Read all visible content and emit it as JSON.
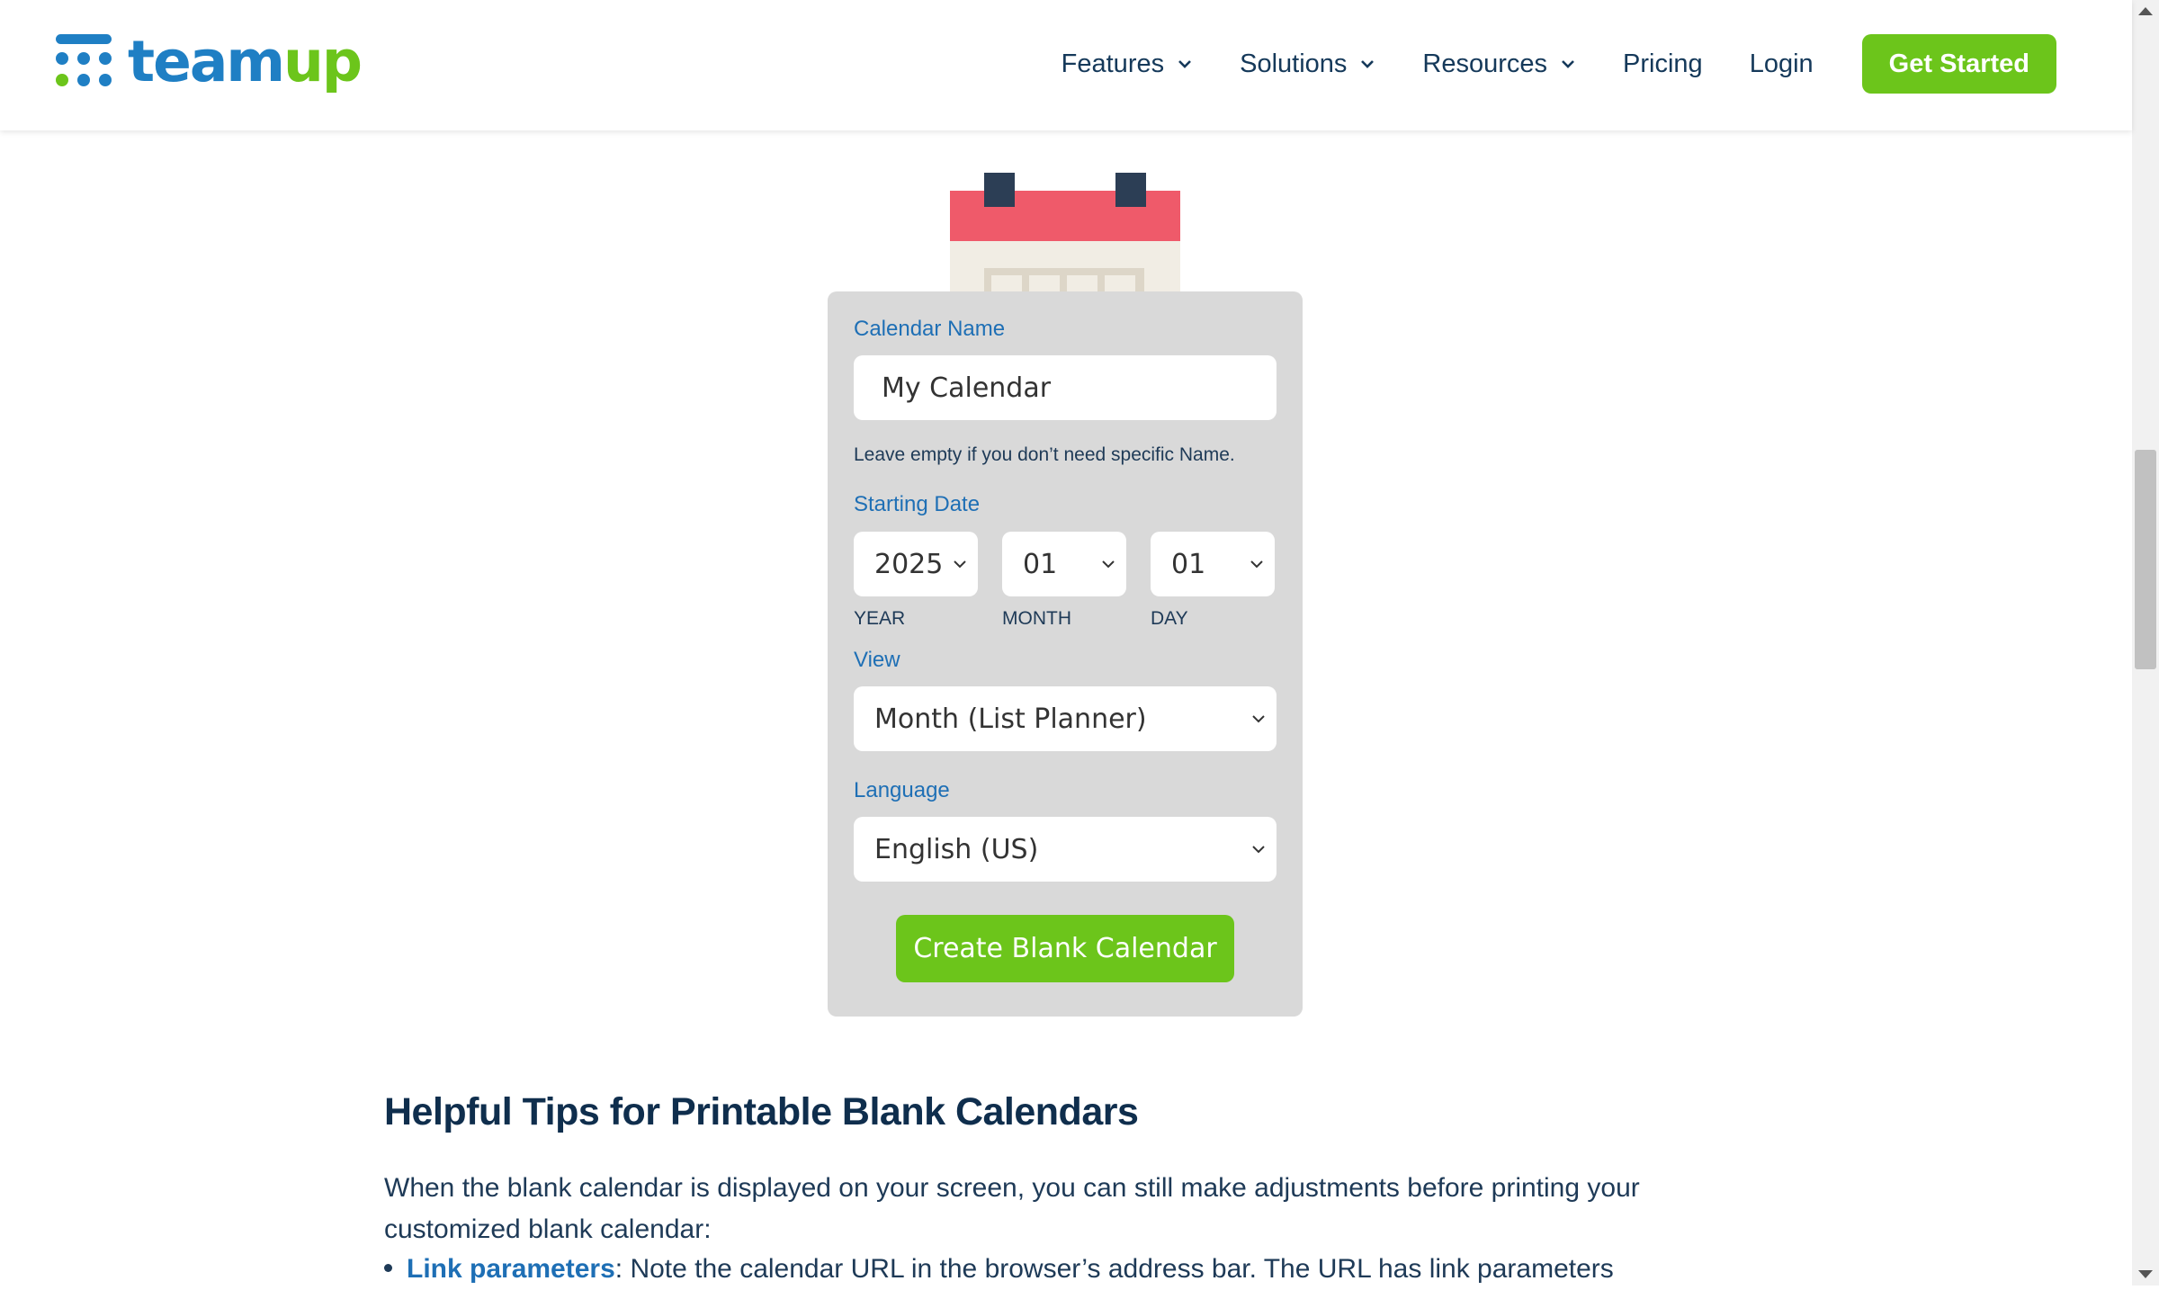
{
  "header": {
    "logo": {
      "team": "team",
      "up": "up"
    },
    "nav": [
      {
        "label": "Features",
        "has_dropdown": true
      },
      {
        "label": "Solutions",
        "has_dropdown": true
      },
      {
        "label": "Resources",
        "has_dropdown": true
      },
      {
        "label": "Pricing",
        "has_dropdown": false
      },
      {
        "label": "Login",
        "has_dropdown": false
      }
    ],
    "cta_label": "Get Started"
  },
  "form": {
    "calendar_name_label": "Calendar Name",
    "calendar_name_value": "My Calendar",
    "calendar_name_hint": "Leave empty if you don’t need specific Name.",
    "starting_date_label": "Starting Date",
    "year": {
      "value": "2025",
      "label": "YEAR"
    },
    "month": {
      "value": "01",
      "label": "MONTH"
    },
    "day": {
      "value": "01",
      "label": "DAY"
    },
    "view_label": "View",
    "view_value": "Month (List Planner)",
    "language_label": "Language",
    "language_value": "English (US)",
    "submit_label": "Create Blank Calendar"
  },
  "article": {
    "heading": "Helpful Tips for Printable Blank Calendars",
    "paragraph": "When the blank calendar is displayed on your screen, you can still make adjustments before printing your customized blank calendar:",
    "bullets": [
      {
        "link": "Link parameters",
        "text": ": Note the calendar URL in the browser’s address bar. The URL has link parameters"
      }
    ]
  },
  "colors": {
    "brand_blue": "#1f7fc4",
    "brand_green": "#6cc51b",
    "calendar_red": "#ef5a6a",
    "calendar_ring": "#2c3e55",
    "card_bg": "#d9d9d9"
  },
  "icons": [
    "teamup-logo-icon",
    "chevron-down-icon",
    "calendar-illustration-icon"
  ]
}
